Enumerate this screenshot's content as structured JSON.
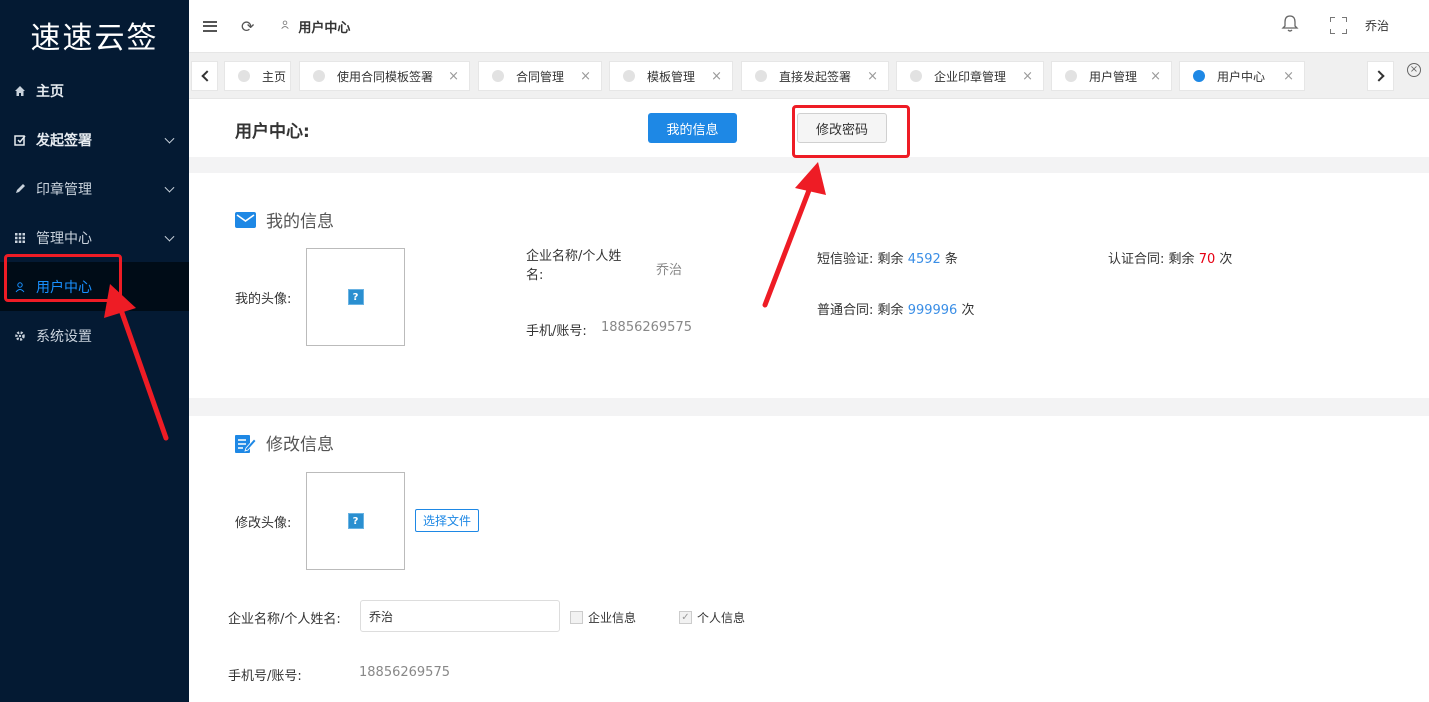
{
  "sidebar": {
    "logo": "速速云签",
    "items": [
      {
        "label": "主页",
        "icon": "home-icon"
      },
      {
        "label": "发起签署",
        "icon": "sign-icon"
      },
      {
        "label": "印章管理",
        "icon": "pen-icon"
      },
      {
        "label": "管理中心",
        "icon": "grid-icon"
      },
      {
        "label": "用户中心",
        "icon": "user-icon"
      },
      {
        "label": "系统设置",
        "icon": "gear-icon"
      }
    ]
  },
  "header": {
    "breadcrumb": "用户中心",
    "user": "乔治"
  },
  "tabs": [
    {
      "label": "主页"
    },
    {
      "label": "使用合同模板签署"
    },
    {
      "label": "合同管理"
    },
    {
      "label": "模板管理"
    },
    {
      "label": "直接发起签署"
    },
    {
      "label": "企业印章管理"
    },
    {
      "label": "用户管理"
    },
    {
      "label": "用户中心"
    }
  ],
  "tab_close": "×",
  "close_all": "×",
  "page": {
    "title": "用户中心:",
    "btn_my_info": "我的信息",
    "btn_change_password": "修改密码"
  },
  "my_info": {
    "title": "我的信息",
    "avatar_label": "我的头像:",
    "avatar_placeholder": "?",
    "name_label_line1": "企业名称/个人姓",
    "name_label_line2": "名:",
    "name_value": "乔治",
    "phone_label": "手机/账号:",
    "phone_value": "18856269575",
    "sms_label": "短信验证:",
    "sms_prefix": "剩余",
    "sms_count": "4592",
    "sms_unit": "条",
    "auth_label": "认证合同:",
    "auth_prefix": "剩余",
    "auth_count": "70",
    "auth_unit": "次",
    "normal_label": "普通合同:",
    "normal_prefix": "剩余",
    "normal_count": "999996",
    "normal_unit": "次"
  },
  "edit_info": {
    "title": "修改信息",
    "avatar_label": "修改头像:",
    "avatar_placeholder": "?",
    "file_button": "选择文件",
    "name_label": "企业名称/个人姓名:",
    "name_value": "乔治",
    "chk_company": "企业信息",
    "chk_personal": "个人信息",
    "chk_personal_mark": "✓",
    "phone_label": "手机号/账号:",
    "phone_value": "18856269575"
  },
  "colors": {
    "sidebar_bg": "#041a33",
    "accent": "#1e88e5",
    "highlight_red": "#ee1c25"
  }
}
